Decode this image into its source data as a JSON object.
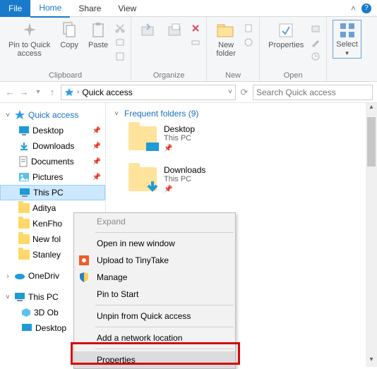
{
  "tabs": {
    "file": "File",
    "home": "Home",
    "share": "Share",
    "view": "View"
  },
  "ribbon": {
    "clipboard": {
      "label": "Clipboard",
      "pin": "Pin to Quick\naccess",
      "copy": "Copy",
      "paste": "Paste"
    },
    "organize": {
      "label": "Organize"
    },
    "new": {
      "label": "New",
      "newfolder": "New\nfolder"
    },
    "open": {
      "label": "Open",
      "properties": "Properties"
    },
    "select": {
      "label": "Select"
    }
  },
  "breadcrumb": {
    "text": "Quick access"
  },
  "search": {
    "placeholder": "Search Quick access"
  },
  "nav": {
    "quickaccess": "Quick access",
    "items": [
      {
        "label": "Desktop"
      },
      {
        "label": "Downloads"
      },
      {
        "label": "Documents"
      },
      {
        "label": "Pictures"
      },
      {
        "label": "This PC"
      },
      {
        "label": "Aditya"
      },
      {
        "label": "KenFho"
      },
      {
        "label": "New fol"
      },
      {
        "label": "Stanley"
      }
    ],
    "onedrive": "OneDriv",
    "thispc": "This PC",
    "thispc_children": [
      {
        "label": "3D Ob"
      },
      {
        "label": "Desktop"
      }
    ]
  },
  "section": {
    "title": "Frequent folders (9)"
  },
  "frequent": [
    {
      "name": "Desktop",
      "sub": "This PC"
    },
    {
      "name": "Downloads",
      "sub": "This PC"
    }
  ],
  "context": {
    "expand": "Expand",
    "open_new": "Open in new window",
    "upload": "Upload to TinyTake",
    "manage": "Manage",
    "pin_start": "Pin to Start",
    "unpin_quick": "Unpin from Quick access",
    "add_net": "Add a network location",
    "properties": "Properties"
  }
}
